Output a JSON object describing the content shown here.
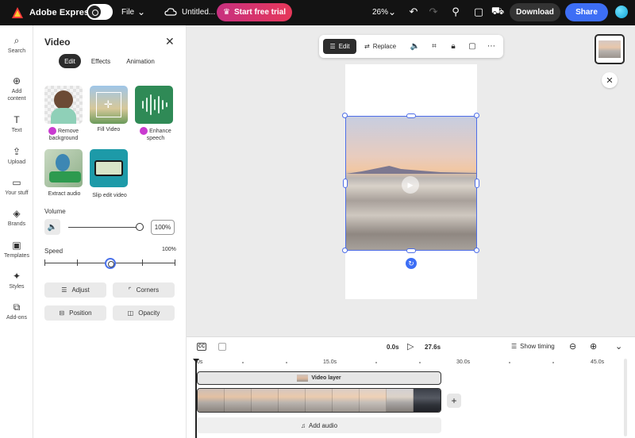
{
  "app": {
    "brand": "Adobe Express",
    "file_menu": "File",
    "doc_title": "Untitled...",
    "trial_label": "Start free trial",
    "zoom": "26%",
    "download_label": "Download",
    "share_label": "Share"
  },
  "rail": [
    {
      "label": "Search",
      "icon": "search-icon",
      "glyph": "⌕"
    },
    {
      "label": "Add content",
      "icon": "plus-circle-icon",
      "glyph": "⊕"
    },
    {
      "label": "Text",
      "icon": "text-icon",
      "glyph": "T"
    },
    {
      "label": "Upload",
      "icon": "upload-icon",
      "glyph": "⇪"
    },
    {
      "label": "Your stuff",
      "icon": "folder-icon",
      "glyph": "▭"
    },
    {
      "label": "Brands",
      "icon": "brands-icon",
      "glyph": "◈"
    },
    {
      "label": "Templates",
      "icon": "templates-icon",
      "glyph": "▣"
    },
    {
      "label": "Styles",
      "icon": "styles-icon",
      "glyph": "✦"
    },
    {
      "label": "Add-ons",
      "icon": "addons-icon",
      "glyph": "⧉"
    }
  ],
  "panel": {
    "title": "Video",
    "tabs": [
      "Edit",
      "Effects",
      "Animation"
    ],
    "active_tab": "Edit",
    "tools": [
      {
        "label": "Remove background",
        "premium": true
      },
      {
        "label": "Fill Video",
        "premium": false
      },
      {
        "label": "Enhance speech",
        "premium": true
      },
      {
        "label": "Extract audio",
        "premium": false
      },
      {
        "label": "Slip edit video",
        "premium": false
      }
    ],
    "volume_label": "Volume",
    "volume_value": "100%",
    "volume_level": 1.0,
    "speed_label": "Speed",
    "speed_value": "100%",
    "speed_level": 0.5,
    "buttons": [
      "Adjust",
      "Corners",
      "Position",
      "Opacity"
    ]
  },
  "toolbar": {
    "edit_label": "Edit",
    "replace_label": "Replace"
  },
  "timeline": {
    "current_time": "0.0s",
    "total_time": "27.6s",
    "show_timing": "Show timing",
    "ruler": [
      "0s",
      "15.0s",
      "30.0s",
      "45.0s"
    ],
    "layer_label": "Video layer",
    "add_audio": "Add audio"
  },
  "colors": {
    "accent": "#3d6ef5",
    "selection": "#4e6ee8",
    "trial_gradient_start": "#c7307f",
    "trial_gradient_end": "#e6385a",
    "premium": "#c93bd0"
  }
}
